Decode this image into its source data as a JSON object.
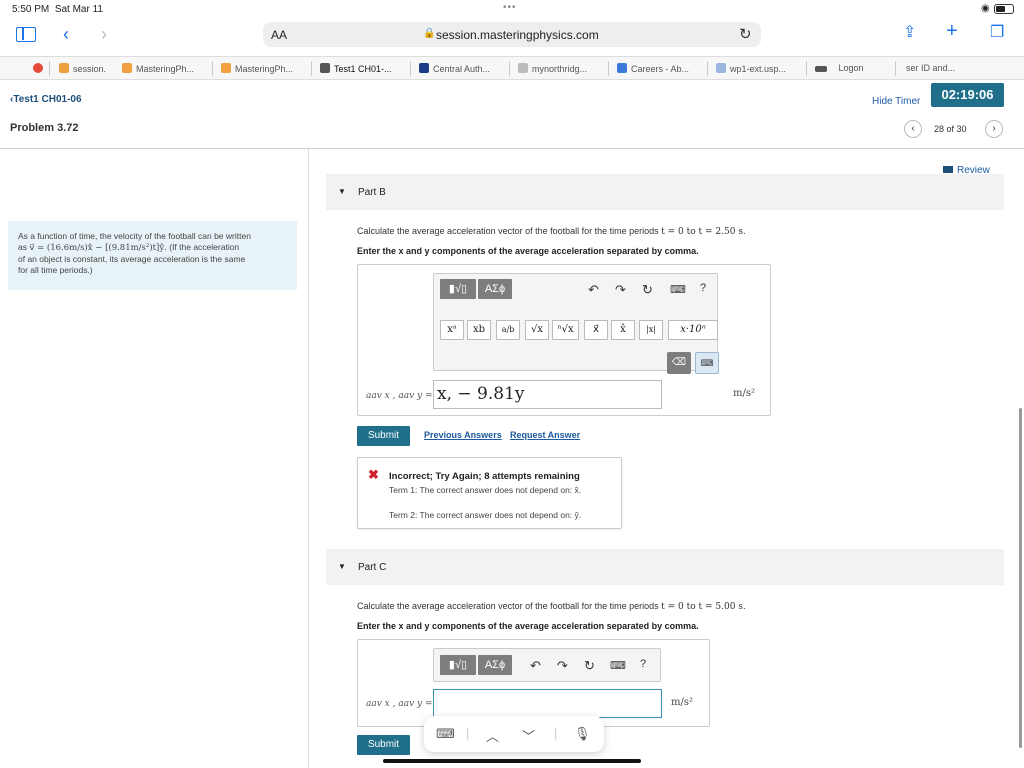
{
  "status": {
    "time": "5:50 PM",
    "date": "Sat Mar 11"
  },
  "browser": {
    "aa_label": "AA",
    "url": "session.masteringphysics.com",
    "tabs": [
      "session.",
      "MasteringPh...",
      "MasteringPh...",
      "Test1 CH01-...",
      "Central Auth...",
      "mynorthridg...",
      "Careers - Ab...",
      "wp1-ext.usp...",
      "Logon",
      "ser ID and..."
    ]
  },
  "header": {
    "back_link": "Test1 CH01-06",
    "hide_timer": "Hide Timer",
    "timer": "02:19:06",
    "problem_title": "Problem 3.72",
    "pager": "28 of 30",
    "review": "Review"
  },
  "prompt": {
    "line1": "As a function of time, the velocity of the football can be written",
    "line2_pre": "as ",
    "line2_math": "v⃗ = (16.6m/s)x̂ − [(9.81m/s²)t]ŷ.",
    "line2_post": " (If the acceleration",
    "line3": "of an object is constant, its average acceleration is the same",
    "line4": "for all time periods.)"
  },
  "editor": {
    "template_button": "▮√▯",
    "greek_button": "ΑΣϕ",
    "help": "?",
    "symbols": [
      "xᵃ",
      "xb",
      "a/b",
      "√x",
      "ⁿ√x",
      "x⃗",
      "x̂",
      "|x|",
      "x·10ⁿ"
    ],
    "delete_key": "⌫",
    "keyboard_key": "⌨"
  },
  "part_b": {
    "label": "Part B",
    "question_pre": "Calculate the average acceleration vector of the football for the time periods ",
    "question_math": "t = 0 to t = 2.50 s.",
    "instruction": "Enter the x and y components of the average acceleration separated by comma.",
    "var_label": "aav x , aav y =",
    "answer_value": "x, − 9.81y",
    "unit": "m/s²",
    "submit": "Submit",
    "previous_answers": "Previous Answers",
    "request_answer": "Request Answer",
    "feedback": {
      "title": "Incorrect; Try Again; 8 attempts remaining",
      "term1": "Term 1: The correct answer does not depend on: x̂.",
      "term2": "Term 2: The correct answer does not depend on: ŷ."
    }
  },
  "part_c": {
    "label": "Part C",
    "question_pre": "Calculate the average acceleration vector of the football for the time periods ",
    "question_math": "t = 0 to t = 5.00 s.",
    "instruction": "Enter the x and y components of the average acceleration separated by comma.",
    "var_label": "aav x , aav y =",
    "answer_value": "",
    "unit": "m/s²",
    "submit": "Submit"
  },
  "colors": {
    "accent": "#1f6f8b",
    "link": "#1d5aa0",
    "error": "#d0202e",
    "prompt_bg": "#e8f3f8"
  }
}
